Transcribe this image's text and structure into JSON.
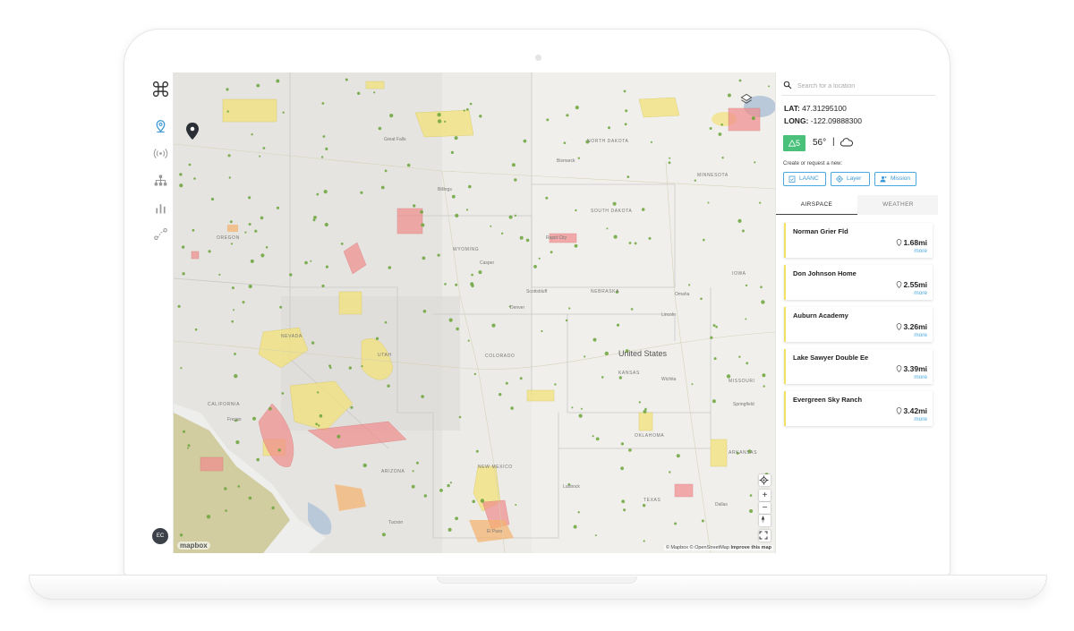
{
  "nav": {
    "items": [
      {
        "name": "location-icon",
        "active": true
      },
      {
        "name": "broadcast-icon",
        "active": false
      },
      {
        "name": "hierarchy-icon",
        "active": false
      },
      {
        "name": "bar-chart-icon",
        "active": false
      },
      {
        "name": "route-icon",
        "active": false
      }
    ],
    "avatar_initials": "EC"
  },
  "map": {
    "country_label": "United States",
    "state_labels": [
      {
        "text": "NORTH DAKOTA",
        "name": "label-north-dakota"
      },
      {
        "text": "MINNESOTA",
        "name": "label-minnesota"
      },
      {
        "text": "SOUTH DAKOTA",
        "name": "label-south-dakota"
      },
      {
        "text": "WYOMING",
        "name": "label-wyoming"
      },
      {
        "text": "NEBRASKA",
        "name": "label-nebraska"
      },
      {
        "text": "IOWA",
        "name": "label-iowa"
      },
      {
        "text": "OREGON",
        "name": "label-oregon"
      },
      {
        "text": "NEVADA",
        "name": "label-nevada"
      },
      {
        "text": "UTAH",
        "name": "label-utah"
      },
      {
        "text": "COLORADO",
        "name": "label-colorado"
      },
      {
        "text": "KANSAS",
        "name": "label-kansas"
      },
      {
        "text": "MISSOURI",
        "name": "label-missouri"
      },
      {
        "text": "CALIFORNIA",
        "name": "label-california"
      },
      {
        "text": "ARIZONA",
        "name": "label-arizona"
      },
      {
        "text": "NEW MEXICO",
        "name": "label-new-mexico"
      },
      {
        "text": "OKLAHOMA",
        "name": "label-oklahoma"
      },
      {
        "text": "ARKANSAS",
        "name": "label-arkansas"
      },
      {
        "text": "TEXAS",
        "name": "label-texas"
      }
    ],
    "city_labels": [
      {
        "text": "Bismarck",
        "name": "label-bismarck"
      },
      {
        "text": "Great Falls",
        "name": "label-great-falls"
      },
      {
        "text": "Billings",
        "name": "label-billings"
      },
      {
        "text": "Rapid City",
        "name": "label-rapid-city"
      },
      {
        "text": "Casper",
        "name": "label-casper"
      },
      {
        "text": "Scottsbluff",
        "name": "label-scottsbluff"
      },
      {
        "text": "Denver",
        "name": "label-denver"
      },
      {
        "text": "Omaha",
        "name": "label-omaha"
      },
      {
        "text": "Lincoln",
        "name": "label-lincoln"
      },
      {
        "text": "Wichita",
        "name": "label-wichita"
      },
      {
        "text": "Springfield",
        "name": "label-springfield"
      },
      {
        "text": "Lubbock",
        "name": "label-lubbock"
      },
      {
        "text": "Dallas",
        "name": "label-dallas"
      },
      {
        "text": "Tucson",
        "name": "label-tucson"
      },
      {
        "text": "El Paso",
        "name": "label-el-paso"
      },
      {
        "text": "Fresno",
        "name": "label-fresno"
      }
    ],
    "mapbox_logo": "mapbox",
    "attribution_mapbox": "© Mapbox",
    "attribution_osm": "© OpenStreetMap",
    "attribution_improve": "Improve this map",
    "zoom_in_label": "+",
    "zoom_out_label": "−",
    "colors": {
      "caution_fill": "#f3e37a",
      "restricted_fill": "#f08c8c",
      "warning_fill": "#f5b26b",
      "airport_dot": "#6ba539",
      "water": "#b9c9d9",
      "tribal": "#c9c48f"
    }
  },
  "panel": {
    "search_placeholder": "Search for a location",
    "lat_label": "LAT:",
    "lat_value": "47.31295100",
    "long_label": "LONG:",
    "long_value": "-122.09888300",
    "advisory_count": "5",
    "temperature": "56°",
    "divider": "|",
    "create_label": "Create or request a new:",
    "actions": [
      {
        "label": "LAANC",
        "name": "laanc-button"
      },
      {
        "label": "Layer",
        "name": "layer-button"
      },
      {
        "label": "Mission",
        "name": "mission-button"
      }
    ],
    "tabs": [
      {
        "label": "AIRSPACE",
        "active": true
      },
      {
        "label": "WEATHER",
        "active": false
      }
    ],
    "airspace_items": [
      {
        "name": "Norman Grier Fld",
        "distance": "1.68mi",
        "more": "more"
      },
      {
        "name": "Don Johnson Home",
        "distance": "2.55mi",
        "more": "more"
      },
      {
        "name": "Auburn Academy",
        "distance": "3.26mi",
        "more": "more"
      },
      {
        "name": "Lake Sawyer Double Ee",
        "distance": "3.39mi",
        "more": "more"
      },
      {
        "name": "Evergreen Sky Ranch",
        "distance": "3.42mi",
        "more": "more"
      }
    ]
  }
}
